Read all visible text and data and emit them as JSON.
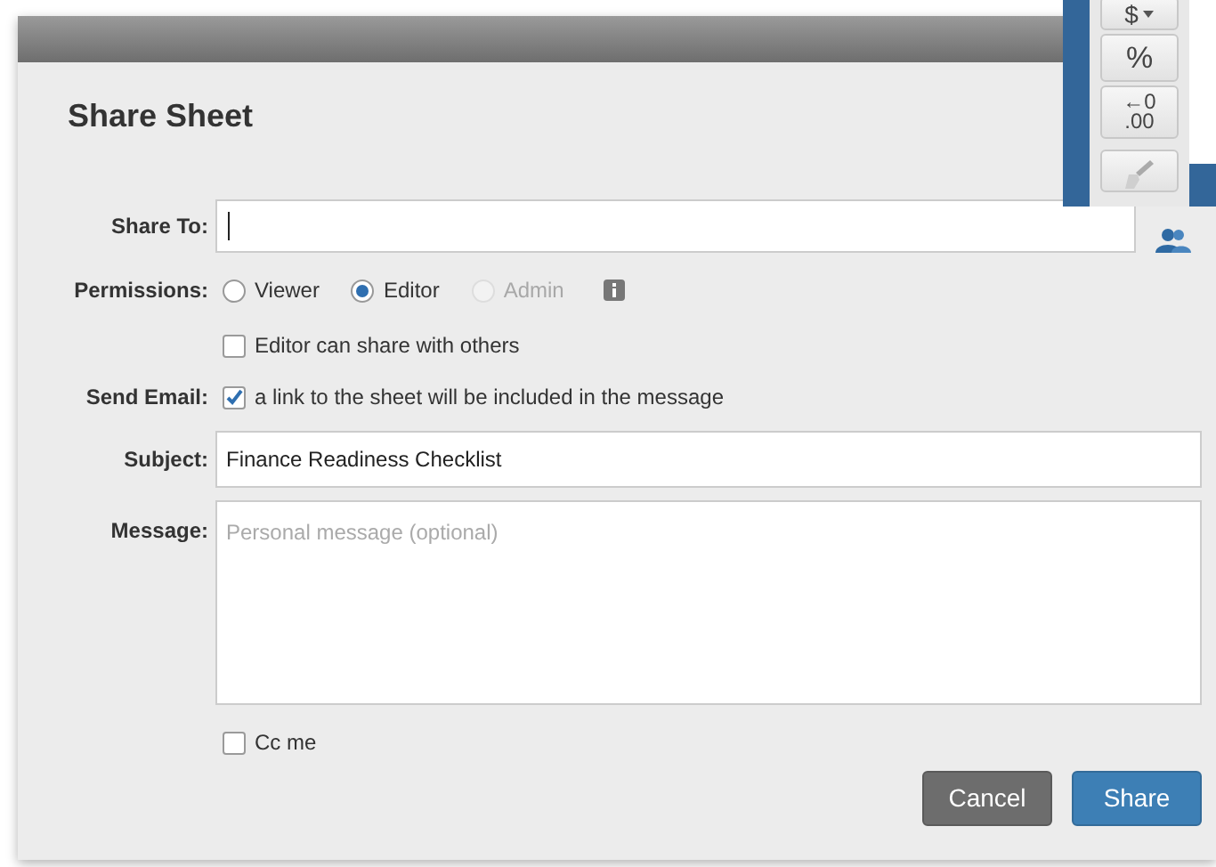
{
  "dialog": {
    "title": "Share Sheet",
    "share_to": {
      "label": "Share To:"
    },
    "permissions": {
      "label": "Permissions:",
      "options": [
        {
          "label": "Viewer",
          "selected": false,
          "disabled": false
        },
        {
          "label": "Editor",
          "selected": true,
          "disabled": false
        },
        {
          "label": "Admin",
          "selected": false,
          "disabled": true
        }
      ]
    },
    "editor_can_share": {
      "label": "Editor can share with others",
      "checked": false
    },
    "send_email": {
      "label": "Send Email:",
      "text": "a link to the sheet will be included in the message",
      "checked": true
    },
    "subject": {
      "label": "Subject:",
      "value": "Finance Readiness Checklist"
    },
    "message": {
      "label": "Message:",
      "placeholder": "Personal message (optional)"
    },
    "cc_me": {
      "label": "Cc me",
      "checked": false
    },
    "buttons": [
      {
        "label": "Cancel",
        "kind": "secondary"
      },
      {
        "label": "Share",
        "kind": "primary"
      }
    ]
  },
  "toolbar": {
    "buttons": [
      {
        "kind": "dropdown",
        "label": "$"
      },
      {
        "kind": "text",
        "label": "%"
      },
      {
        "kind": "stacked",
        "label": "←0",
        "sublabel": ".00"
      },
      {
        "kind": "brush"
      }
    ]
  }
}
